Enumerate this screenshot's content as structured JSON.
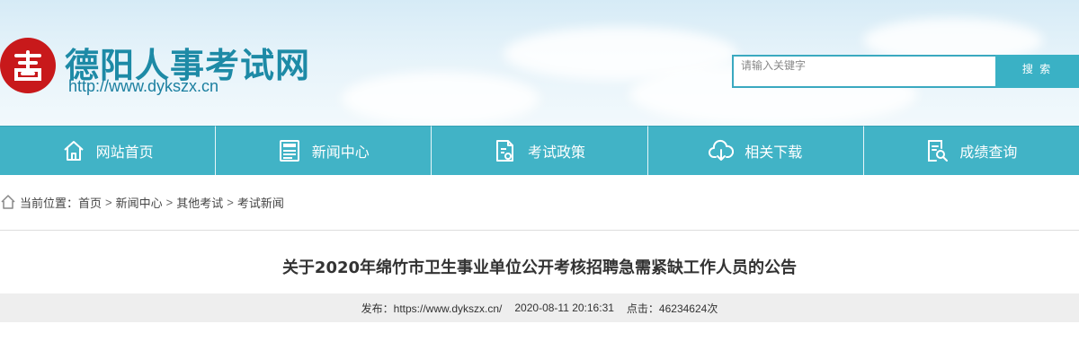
{
  "header": {
    "site_title": "德阳人事考试网",
    "site_url": "http://www.dykszx.cn"
  },
  "search": {
    "placeholder": "请输入关键字",
    "button_label": "搜 索"
  },
  "nav": {
    "items": [
      {
        "label": "网站首页",
        "icon": "home-icon"
      },
      {
        "label": "新闻中心",
        "icon": "news-icon"
      },
      {
        "label": "考试政策",
        "icon": "policy-icon"
      },
      {
        "label": "相关下载",
        "icon": "cloud-download-icon"
      },
      {
        "label": "成绩查询",
        "icon": "search-document-icon"
      }
    ]
  },
  "breadcrumb": {
    "prefix": "当前位置：",
    "items": [
      "首页",
      "新闻中心",
      "其他考试",
      "考试新闻"
    ],
    "separator": ">"
  },
  "article": {
    "title": "关于2020年绵竹市卫生事业单位公开考核招聘急需紧缺工作人员的公告",
    "publisher": "发布：https://www.dykszx.cn/",
    "date": "2020-08-11 20:16:31",
    "clicks": "点击：46234624次"
  },
  "colors": {
    "nav_bg": "#41b3c6",
    "title_blue": "#1d8aa6",
    "seal_red": "#c8191b"
  }
}
